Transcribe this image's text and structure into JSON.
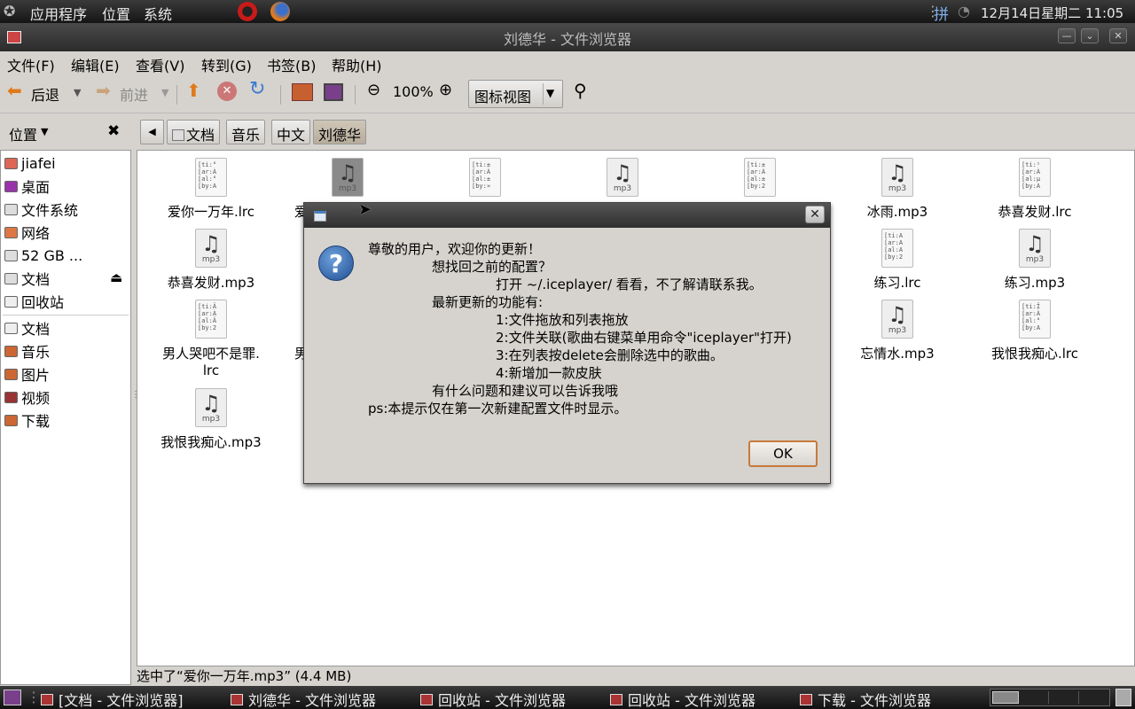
{
  "top_panel": {
    "menus": [
      "应用程序",
      "位置",
      "系统"
    ],
    "ime_label": "拼",
    "clock": "12月14日星期二 11:05"
  },
  "window": {
    "title": "刘德华 - 文件浏览器"
  },
  "menubar": {
    "items": [
      "文件(F)",
      "编辑(E)",
      "查看(V)",
      "转到(G)",
      "书签(B)",
      "帮助(H)"
    ]
  },
  "toolbar": {
    "back_label": "后退",
    "forward_label": "前进",
    "zoom_level": "100%",
    "view_mode": "图标视图"
  },
  "sidebar": {
    "header": "位置",
    "items": [
      {
        "label": "jiafei",
        "icon": "home-folder-icon"
      },
      {
        "label": "桌面",
        "icon": "desktop-icon"
      },
      {
        "label": "文件系统",
        "icon": "filesystem-icon"
      },
      {
        "label": "网络",
        "icon": "network-icon"
      },
      {
        "label": "52 GB ...",
        "icon": "drive-icon"
      },
      {
        "label": "文档",
        "icon": "drive-icon"
      },
      {
        "label": "回收站",
        "icon": "trash-icon"
      },
      {
        "label": "文档",
        "icon": "folder-icon"
      },
      {
        "label": "音乐",
        "icon": "music-folder-icon"
      },
      {
        "label": "图片",
        "icon": "pictures-folder-icon"
      },
      {
        "label": "视频",
        "icon": "video-folder-icon"
      },
      {
        "label": "下载",
        "icon": "download-folder-icon"
      }
    ]
  },
  "pathbar": {
    "crumbs": [
      "文档",
      "音乐",
      "中文",
      "刘德华"
    ]
  },
  "files": [
    {
      "name": "爱你一万年.lrc",
      "type": "lrc",
      "preview": "[ti:°\n[ar:À\n[al:°\n[by:A"
    },
    {
      "name": "爱",
      "type": "mp3"
    },
    {
      "name": "",
      "type": "lrc",
      "preview": "[ti:±\n[ar:À\n[al:±\n[by:»"
    },
    {
      "name": "",
      "type": "mp3"
    },
    {
      "name": "",
      "type": "lrc",
      "preview": "[ti:±\n[ar:À\n[al:±\n[by:2"
    },
    {
      "name": "冰雨.mp3",
      "type": "mp3"
    },
    {
      "name": "恭喜发财.lrc",
      "type": "lrc",
      "preview": "[ti:¹\n[ar:À\n[al:µ\n[by:A"
    },
    {
      "name": "恭喜发财.mp3",
      "type": "mp3"
    },
    {
      "name": "练习.lrc",
      "type": "lrc",
      "preview": "[ti:A\n[ar:A\n[al:A\n[by:2"
    },
    {
      "name": "练习.mp3",
      "type": "mp3"
    },
    {
      "name": "男人哭吧不是罪.\nlrc",
      "type": "lrc",
      "preview": "[ti:Ä\n[ar:À\n[al:Ä\n[by:2"
    },
    {
      "name": "男",
      "type": "hidden"
    },
    {
      "name": "忘情水.mp3",
      "type": "mp3"
    },
    {
      "name": "我恨我痴心.lrc",
      "type": "lrc",
      "preview": "[ti:Î\n[ar:À\n[al:°\n[by:A"
    },
    {
      "name": "我恨我痴心.mp3",
      "type": "mp3"
    }
  ],
  "mp3_icon_label": "mp3",
  "statusbar": {
    "text": "选中了“爱你一万年.mp3” (4.4 MB)"
  },
  "dialog": {
    "lines": [
      "尊敬的用户，欢迎你的更新！",
      "想找回之前的配置？",
      "打开 ~/.iceplayer/ 看看，不了解请联系我。",
      "最新更新的功能有:",
      "1:文件拖放和列表拖放",
      "2:文件关联(歌曲右键菜单用命令\"iceplayer\"打开)",
      "3:在列表按delete会删除选中的歌曲。",
      "4:新增加一款皮肤",
      "有什么问题和建议可以告诉我哦",
      "ps:本提示仅在第一次新建配置文件时显示。"
    ],
    "ok_label": "OK"
  },
  "taskbar": {
    "tasks": [
      "[文档 - 文件浏览器]",
      "刘德华 - 文件浏览器",
      "回收站 - 文件浏览器",
      "回收站 - 文件浏览器",
      "下载 - 文件浏览器"
    ]
  }
}
